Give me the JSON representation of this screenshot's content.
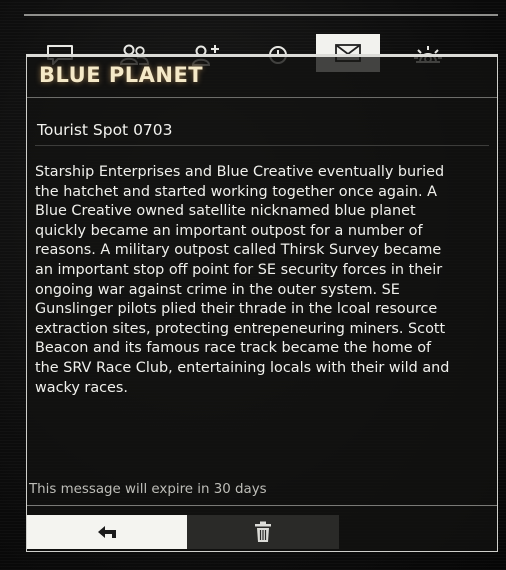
{
  "tabs": [
    {
      "id": "chat",
      "icon": "chat-bubble-icon",
      "active": false
    },
    {
      "id": "contacts",
      "icon": "people-icon",
      "active": false
    },
    {
      "id": "add-friend",
      "icon": "add-person-icon",
      "active": false
    },
    {
      "id": "history",
      "icon": "clock-icon",
      "active": false
    },
    {
      "id": "inbox",
      "icon": "envelope-icon",
      "active": true
    },
    {
      "id": "settings",
      "icon": "gear-icon",
      "active": false
    }
  ],
  "message": {
    "title": "BLUE PLANET",
    "subject": "Tourist Spot 0703",
    "body": "Starship Enterprises and Blue Creative eventually buried\nthe hatchet and started working together once again. A\nBlue Creative owned satellite nicknamed blue planet\nquickly became an important outpost for a number of\nreasons. A military outpost called Thirsk Survey became\nan important stop off point for SE security forces in their\nongoing war against crime in the outer system. SE\nGunslinger pilots plied their thrade in the lcoal resource\nextraction sites, protecting entrepeneuring miners. Scott\nBeacon and its famous race track became the home of\nthe SRV Race Club, entertaining locals with their wild and\nwacky races.",
    "expiry": "This message will expire in 30 days"
  },
  "actions": {
    "back_icon": "back-arrow-icon",
    "delete_icon": "trash-icon"
  },
  "colors": {
    "title": "#f5e9c8",
    "active_tab": "#f2f2ee",
    "panel_border": "#cfcfcb"
  }
}
